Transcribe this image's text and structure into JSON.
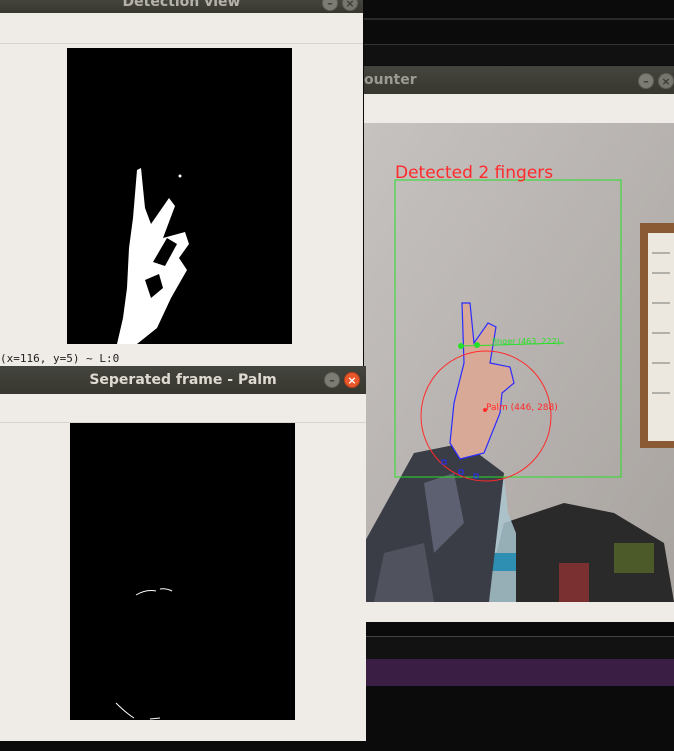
{
  "windows": {
    "detection": {
      "title": "Detection view",
      "status": "(x=116, y=5) ~ L:0"
    },
    "palm": {
      "title": "Seperated frame - Palm"
    },
    "counter": {
      "title": "ounter",
      "overlay": {
        "detected_text": "Detected 2 fingers",
        "fingertip_label": "finger (463, 222)",
        "palm_label": "Palm (446, 288)"
      }
    }
  },
  "colors": {
    "titlebar": "#3e3e38",
    "window_bg": "#efece7",
    "close_active": "#e9582b",
    "overlay_red": "#ff2a2a",
    "overlay_green": "#28e028",
    "contour_blue": "#2b2bff",
    "taskbar_purple": "#3a1e44"
  },
  "icons": {
    "minimize": "minimize-icon",
    "close": "close-icon"
  }
}
